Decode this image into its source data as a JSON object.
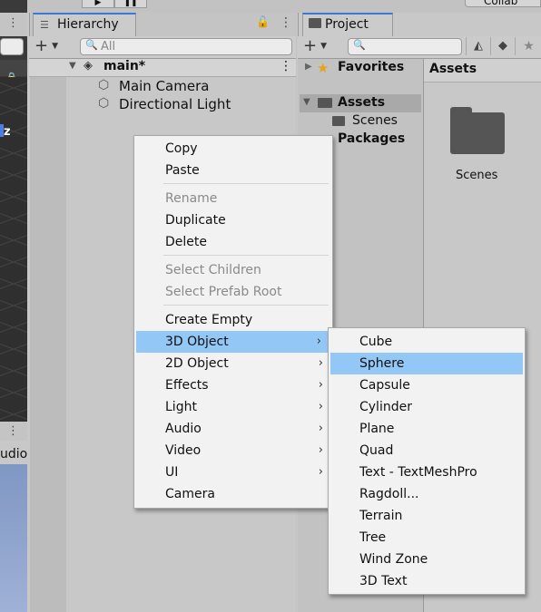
{
  "top_bar": {
    "collab_label": "Collab"
  },
  "scene": {
    "axis_label": "z",
    "audio_label": "udio"
  },
  "hierarchy": {
    "tab_label": "Hierarchy",
    "search_placeholder": "All",
    "scene_name": "main*",
    "items": [
      "Main Camera",
      "Directional Light"
    ]
  },
  "project": {
    "tab_label": "Project",
    "tree": {
      "favorites": "Favorites",
      "assets": "Assets",
      "scenes": "Scenes",
      "packages": "Packages"
    },
    "assets_header": "Assets",
    "folder_label": "Scenes"
  },
  "context_menu": {
    "items": [
      {
        "label": "Copy"
      },
      {
        "label": "Paste"
      },
      {
        "label": "Rename"
      },
      {
        "label": "Duplicate"
      },
      {
        "label": "Delete"
      },
      {
        "label": "Select Children"
      },
      {
        "label": "Select Prefab Root"
      },
      {
        "label": "Create Empty"
      },
      {
        "label": "3D Object"
      },
      {
        "label": "2D Object"
      },
      {
        "label": "Effects"
      },
      {
        "label": "Light"
      },
      {
        "label": "Audio"
      },
      {
        "label": "Video"
      },
      {
        "label": "UI"
      },
      {
        "label": "Camera"
      }
    ]
  },
  "submenu_3d": {
    "items": [
      "Cube",
      "Sphere",
      "Capsule",
      "Cylinder",
      "Plane",
      "Quad",
      "Text - TextMeshPro",
      "Ragdoll...",
      "Terrain",
      "Tree",
      "Wind Zone",
      "3D Text"
    ]
  },
  "colors": {
    "highlight": "#93c7f5",
    "tab_accent": "#3a79d7",
    "favorites_star": "#e8a317"
  }
}
